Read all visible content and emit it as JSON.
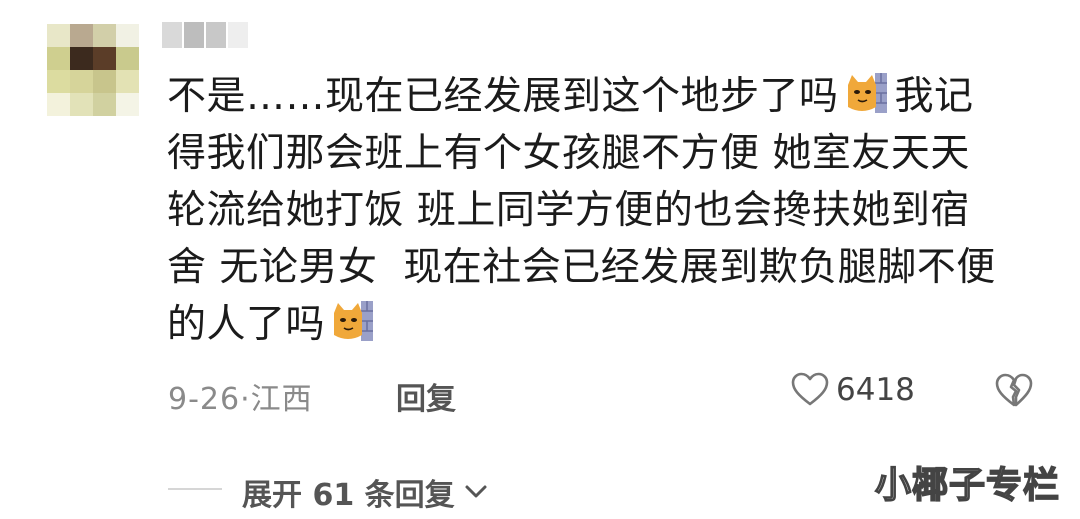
{
  "comment": {
    "line1": "不是……现在已经发展到这个地步了吗",
    "line1_after": "我记",
    "line2": "得我们那会班上有个女孩腿不方便 她室友天天",
    "line3": "轮流给她打饭 班上同学方便的也会搀扶她到宿",
    "line4": "舍 无论男女  现在社会已经发展到欺负腿脚不便",
    "line5": "的人了吗",
    "emoji": "cat-face-wall-emoji"
  },
  "meta": {
    "date_location": "9-26·江西",
    "reply_label": "回复",
    "like_count": "6418"
  },
  "expand": {
    "label": "展开 61 条回复"
  },
  "watermark": "小椰子专栏",
  "colors": {
    "text": "#1b1b1b",
    "meta": "#8a8a8a",
    "action": "#555555"
  }
}
